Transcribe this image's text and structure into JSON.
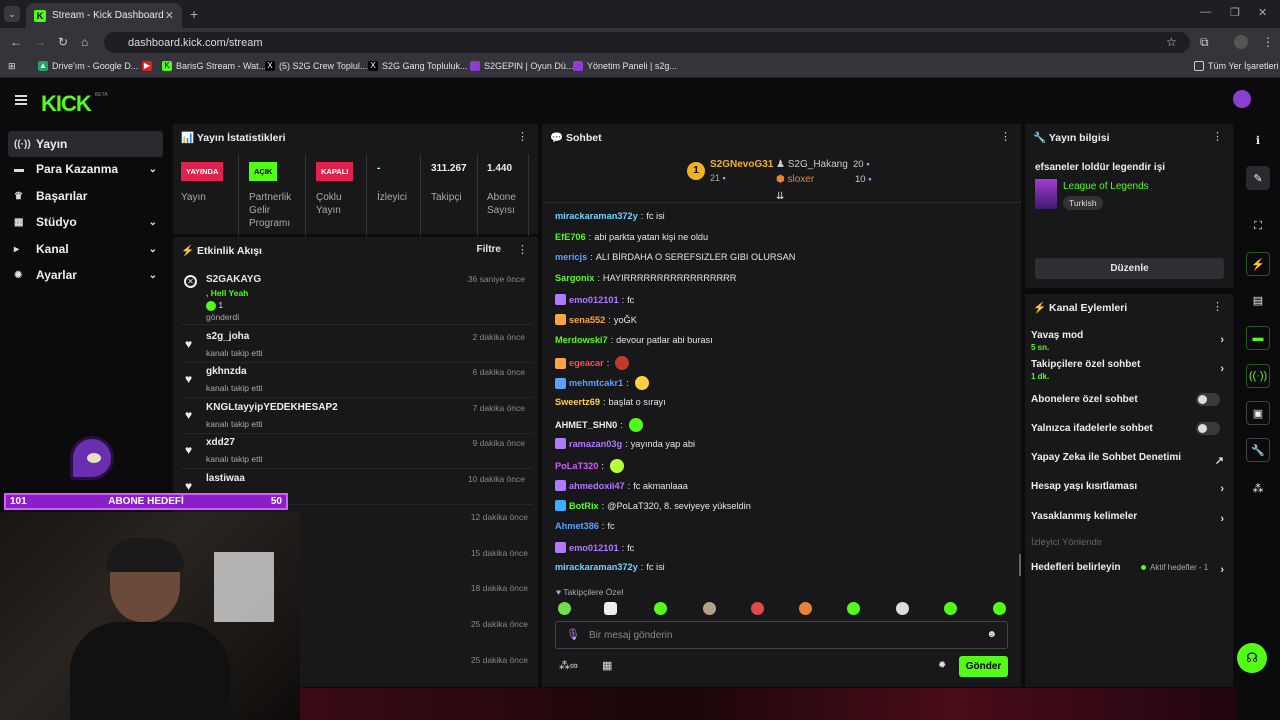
{
  "browser": {
    "tab_title": "Stream - Kick Dashboard",
    "url": "dashboard.kick.com/stream",
    "bookmarks": [
      "Drive'ım - Google D...",
      "BarisG Stream - Wat...",
      "(5) S2G Crew Toplul...",
      "S2G Gang Topluluk...",
      "S2GEPIN | Oyun Dü...",
      "Yönetim Paneli | s2g..."
    ],
    "bookmarks_right": "Tüm Yer İşaretleri"
  },
  "brand": {
    "logo": "KICK",
    "beta": "BETA"
  },
  "sidebar": [
    {
      "label": "Yayın",
      "icon": "broadcast-icon"
    },
    {
      "label": "Para Kazanma",
      "icon": "money-icon"
    },
    {
      "label": "Başarılar",
      "icon": "trophy-icon"
    },
    {
      "label": "Stüdyo",
      "icon": "studio-icon"
    },
    {
      "label": "Kanal",
      "icon": "channel-icon"
    },
    {
      "label": "Ayarlar",
      "icon": "gear-icon"
    }
  ],
  "stats": {
    "title": "Yayın İstatistikleri",
    "yayin": {
      "badge": "YAYINDA",
      "label": "Yayın"
    },
    "partner": {
      "badge": "AÇIK",
      "label1": "Partnerlik",
      "label2": "Gelir",
      "label3": "Programı"
    },
    "coklu": {
      "badge": "KAPALI",
      "label1": "Çoklu",
      "label2": "Yayın"
    },
    "izleyici": {
      "value": "-",
      "label": "İzleyici"
    },
    "takipci": {
      "value": "311.267",
      "label": "Takipçi"
    },
    "abone": {
      "value": "1.440",
      "label1": "Abone",
      "label2": "Sayısı"
    }
  },
  "activity": {
    "title": "Etkinlik Akışı",
    "filter": "Filtre",
    "first": {
      "name": "S2GAKAYG",
      "line1": ", Hell Yeah",
      "count": "1",
      "line3": "gönderdi",
      "time": "36 saniye önce"
    },
    "events": [
      {
        "name": "s2g_joha",
        "sub": "kanalı takip etti",
        "time": "2 dakika önce"
      },
      {
        "name": "gkhnzda",
        "sub": "kanalı takip etti",
        "time": "6 dakika önce"
      },
      {
        "name": "KNGLtayyipYEDEKHESAP2",
        "sub": "kanalı takip etti",
        "time": "7 dakika önce"
      },
      {
        "name": "xdd27",
        "sub": "kanalı takip etti",
        "time": "9 dakika önce"
      },
      {
        "name": "lastiwaa",
        "sub": "",
        "time": "10 dakika önce"
      }
    ],
    "more_times": [
      "12 dakika önce",
      "15 dakika önce",
      "18 dakika önce",
      "25 dakika önce",
      "25 dakika önce"
    ]
  },
  "overlay": {
    "goal_left": "101",
    "goal_label": "ABONE HEDEFİ",
    "goal_right": "50"
  },
  "chat": {
    "title": "Sohbet",
    "top1": {
      "name": "S2GNevoG31",
      "count": "21",
      "rank": "1"
    },
    "top2": {
      "name": "S2G_Hakang",
      "count": "20"
    },
    "top3": {
      "name": "sloxer",
      "count": "10"
    },
    "messages": [
      {
        "user": "mirackaraman372y",
        "color": "#6fd3ff",
        "text": "fc isi"
      },
      {
        "user": "EfE706",
        "color": "#53fc18",
        "text": "abi parkta yatan kişi ne oldu"
      },
      {
        "user": "mericjs",
        "color": "#5aa0ff",
        "text": "ALI BİRDAHA O SEREFSIZLER GIBI OLURSAN"
      },
      {
        "user": "Sargonix",
        "color": "#53fc18",
        "text": "HAYIRRRRRRRRRRRRRRRRR"
      },
      {
        "user": "emo012101",
        "color": "#b07aff",
        "text": "fc"
      },
      {
        "user": "sena552",
        "color": "#ffa53d",
        "text": "yoĞK"
      },
      {
        "user": "Merdowski7",
        "color": "#53fc18",
        "text": "devour patlar abi burası"
      },
      {
        "user": "egeacar",
        "color": "#ff4d4d",
        "text": ""
      },
      {
        "user": "mehmtcakr1",
        "color": "#5aa0ff",
        "text": ""
      },
      {
        "user": "Sweertz69",
        "color": "#ffd23d",
        "text": "başlat o sırayı"
      },
      {
        "user": "AHMET_SHN0",
        "color": "#eeeeee",
        "text": ""
      },
      {
        "user": "ramazan03g",
        "color": "#b07aff",
        "text": "yayında yap abi"
      },
      {
        "user": "PoLaT320",
        "color": "#d05aff",
        "text": ""
      },
      {
        "user": "ahmedoxii47",
        "color": "#b07aff",
        "text": "fc akmanlaaa"
      },
      {
        "user": "BotRix",
        "color": "#53fc18",
        "text": "@PoLaT320, 8. seviyeye yükseldin"
      },
      {
        "user": "Ahmet386",
        "color": "#5aa0ff",
        "text": "fc"
      },
      {
        "user": "emo012101",
        "color": "#b07aff",
        "text": "fc"
      },
      {
        "user": "mirackaraman372y",
        "color": "#6fd3ff",
        "text": "fc isi"
      }
    ],
    "followers_only": "Takipçilere Özel",
    "placeholder": "Bir mesaj gönderin",
    "send": "Gönder"
  },
  "stream_info": {
    "title": "Yayın bilgisi",
    "stream_title": "efsaneler loldür legendir işi",
    "category": "League of Legends",
    "tag": "Turkish",
    "edit": "Düzenle"
  },
  "channel_actions": {
    "title": "Kanal Eylemleri",
    "rows": [
      {
        "label": "Yavaş mod",
        "sub": "5 sn."
      },
      {
        "label": "Takipçilere özel sohbet",
        "sub": "1 dk."
      },
      {
        "label": "Abonelere özel sohbet"
      },
      {
        "label": "Yalnızca ifadelerle sohbet"
      },
      {
        "label": "Yapay Zeka ile Sohbet Denetimi"
      },
      {
        "label": "Hesap yaşı kısıtlaması"
      },
      {
        "label": "Yasaklanmış kelimeler"
      }
    ],
    "viewer_mode": "İzleyici Yönlendir",
    "goals": {
      "label": "Hedefleri belirleyin",
      "status": "Aktif hedefler - 1"
    }
  },
  "accent": "#53fc18"
}
